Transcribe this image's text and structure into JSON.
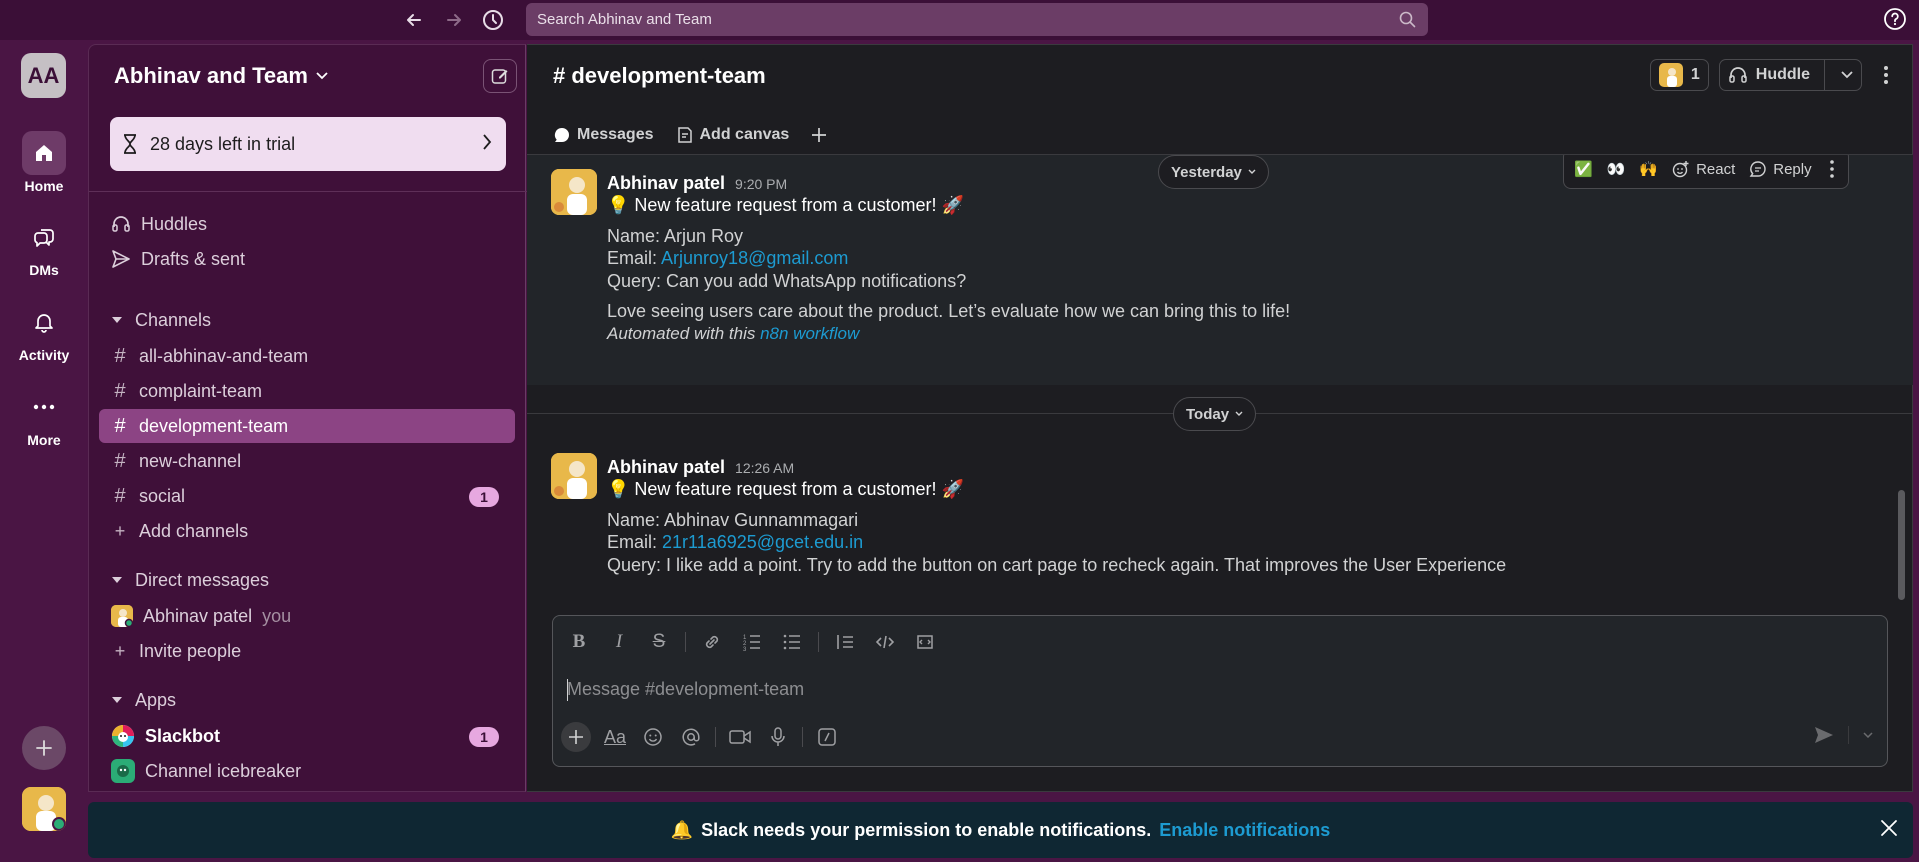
{
  "topbar": {
    "search_placeholder": "Search Abhinav and Team"
  },
  "rail": {
    "workspace_initials": "AA",
    "items": [
      {
        "label": "Home"
      },
      {
        "label": "DMs"
      },
      {
        "label": "Activity"
      },
      {
        "label": "More"
      }
    ]
  },
  "sidebar": {
    "workspace_name": "Abhinav and Team",
    "trial_text": "28 days left in trial",
    "nav": [
      {
        "label": "Huddles"
      },
      {
        "label": "Drafts & sent"
      }
    ],
    "channels_heading": "Channels",
    "channels": [
      {
        "name": "all-abhinav-and-team"
      },
      {
        "name": "complaint-team"
      },
      {
        "name": "development-team"
      },
      {
        "name": "new-channel"
      },
      {
        "name": "social",
        "badge": "1"
      }
    ],
    "add_channels": "Add channels",
    "dm_heading": "Direct messages",
    "dms": [
      {
        "name": "Abhinav patel",
        "suffix": "you"
      }
    ],
    "invite": "Invite people",
    "apps_heading": "Apps",
    "apps": [
      {
        "name": "Slackbot",
        "badge": "1"
      },
      {
        "name": "Channel icebreaker"
      }
    ]
  },
  "channel": {
    "title": "# development-team",
    "member_count": "1",
    "huddle_label": "Huddle",
    "tabs": [
      {
        "label": "Messages"
      },
      {
        "label": "Add canvas"
      }
    ]
  },
  "messages": [
    {
      "author": "Abhinav patel",
      "time": "9:20 PM",
      "headline": "💡 New feature request from a customer! 🚀",
      "name_line": "Name: Arjun Roy",
      "email_prefix": "Email: ",
      "email": "Arjunroy18@gmail.com",
      "query_line": "Query: Can you add WhatsApp notifications?",
      "note": "Love seeing users care about the product. Let’s evaluate how we can bring this to life!",
      "automated_prefix": "Automated with this ",
      "automated_link": "n8n workflow"
    },
    {
      "author": "Abhinav patel",
      "time": "12:26 AM",
      "headline": "💡 New feature request from a customer! 🚀",
      "name_line": "Name: Abhinav Gunnammagari",
      "email_prefix": "Email: ",
      "email": "21r11a6925@gcet.edu.in",
      "query_line": "Query: I like add a point. Try to add the button on cart page to recheck again. That improves the User Experience"
    }
  ],
  "day_dividers": {
    "yesterday": "Yesterday",
    "today": "Today"
  },
  "hover_actions": {
    "emoji1": "✅",
    "emoji2": "👀",
    "emoji3": "🙌",
    "react": "React",
    "reply": "Reply"
  },
  "composer": {
    "placeholder": "Message #development-team"
  },
  "notification": {
    "bell": "🔔",
    "text": "Slack needs your permission to enable notifications.",
    "link": "Enable notifications"
  },
  "colors": {
    "aubergine": "#4a1544",
    "active_channel": "#8c4484",
    "link": "#1d9bd1",
    "badge": "#e7a8e0"
  }
}
